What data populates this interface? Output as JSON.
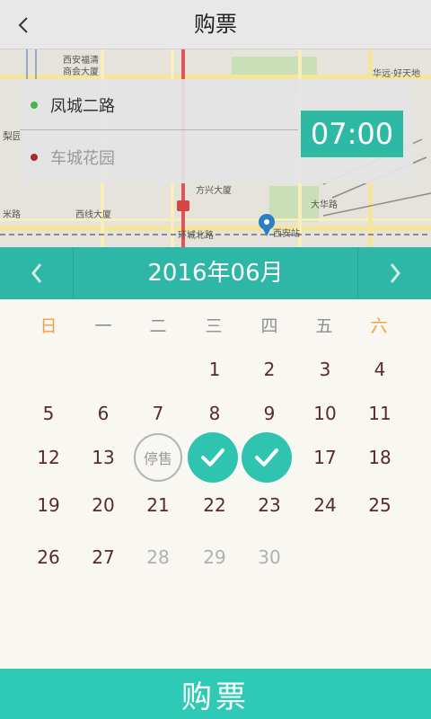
{
  "header": {
    "title": "购票",
    "back_icon": "chevron-left-icon"
  },
  "map": {
    "labels": {
      "l1": "西安福清",
      "l2": "商会大厦",
      "l3": "华远·好天地",
      "l4": "梨园",
      "l5": "方兴大厦",
      "l6": "米路",
      "l7": "西线大厦",
      "l8": "环城北路",
      "l9": "西安站",
      "l10": "大华路"
    }
  },
  "route": {
    "from": "凤城二路",
    "to": "车城花园",
    "time": "07:00",
    "from_color": "#43b54a",
    "to_color": "#a9292b"
  },
  "calendar": {
    "month_title": "2016年06月",
    "prev_icon": "chevron-left-icon",
    "next_icon": "chevron-right-icon",
    "weekdays": [
      "日",
      "一",
      "二",
      "三",
      "四",
      "五",
      "六"
    ],
    "weekend_color": "#f0a144",
    "accent_color": "#2eb7a6",
    "selected_dates": [
      "15",
      "16"
    ],
    "stopped_date": "14",
    "stopped_label": "停售",
    "rows": [
      [
        "",
        "",
        "",
        "1",
        "2",
        "3",
        "4"
      ],
      [
        "5",
        "6",
        "7",
        "8",
        "9",
        "10",
        "11"
      ],
      [
        "12",
        "13",
        "停售",
        "",
        "",
        "17",
        "18"
      ],
      [
        "19",
        "20",
        "21",
        "22",
        "23",
        "24",
        "25"
      ],
      [
        "26",
        "27",
        "28",
        "29",
        "30",
        "",
        ""
      ]
    ],
    "disabled_dates": [
      "28",
      "29",
      "30"
    ]
  },
  "footer": {
    "buy_label": "购票"
  }
}
